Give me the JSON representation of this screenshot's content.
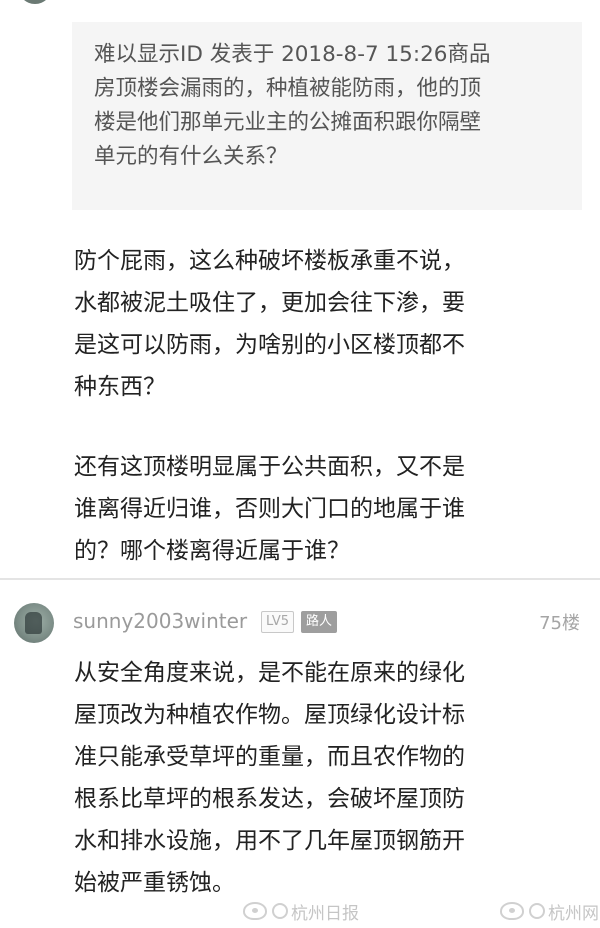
{
  "quote": {
    "lines": [
      "难以显示ID 发表于 2018-8-7 15:26商品",
      "房顶楼会漏雨的，种植被能防雨，他的顶",
      "楼是他们那单元业主的公摊面积跟你隔壁",
      "单元的有什么关系？"
    ]
  },
  "reply": {
    "paragraph1": [
      "防个屁雨，这么种破坏楼板承重不说，",
      "水都被泥土吸住了，更加会往下渗，要",
      "是这可以防雨，为啥别的小区楼顶都不",
      "种东西？"
    ],
    "paragraph2": [
      "还有这顶楼明显属于公共面积，又不是",
      "谁离得近归谁，否则大门口的地属于谁",
      "的？哪个楼离得近属于谁？"
    ]
  },
  "post": {
    "username": "sunny2003winter",
    "level_badge": "LV5",
    "role_badge": "路人",
    "floor": "75楼",
    "lines": [
      "从安全角度来说，是不能在原来的绿化",
      "屋顶改为种植农作物。屋顶绿化设计标",
      "准只能承受草坪的重量，而且农作物的",
      "根系比草坪的根系发达，会破坏屋顶防",
      "水和排水设施，用不了几年屋顶钢筋开",
      "始被严重锈蚀。"
    ]
  },
  "watermarks": {
    "left_text": "杭州日报",
    "right_text": "杭州网",
    "icon": "weibo-icon"
  }
}
